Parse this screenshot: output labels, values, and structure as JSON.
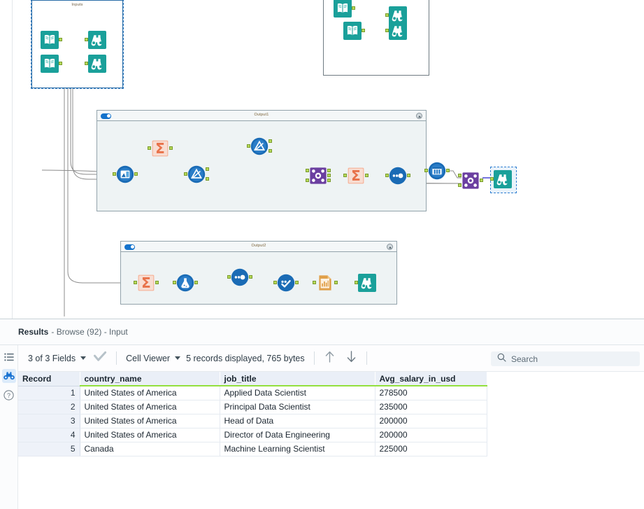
{
  "app": "Alteryx Designer Workflow Canvas",
  "canvas": {
    "containers": [
      {
        "id": "inputs",
        "label": "Inputs",
        "selected": true
      },
      {
        "id": "plain",
        "label": "",
        "selected": false
      },
      {
        "id": "output1",
        "label": "Output1",
        "selected": false,
        "toggle": "on",
        "collapse": "collapse-icon"
      },
      {
        "id": "output2",
        "label": "Output2",
        "selected": false,
        "toggle": "on",
        "collapse": "collapse-icon"
      }
    ],
    "tools": [
      {
        "name": "input-data-tool",
        "icon": "book-icon",
        "container": "inputs"
      },
      {
        "name": "browse-tool",
        "icon": "binoculars-icon",
        "container": "inputs"
      },
      {
        "name": "input-data-tool",
        "icon": "book-icon",
        "container": "inputs"
      },
      {
        "name": "browse-tool",
        "icon": "binoculars-icon",
        "container": "inputs"
      },
      {
        "name": "input-data-tool",
        "icon": "book-icon",
        "container": "plain"
      },
      {
        "name": "browse-tool",
        "icon": "binoculars-icon",
        "container": "plain"
      },
      {
        "name": "input-data-tool",
        "icon": "book-icon",
        "container": "plain"
      },
      {
        "name": "browse-tool",
        "icon": "binoculars-icon",
        "container": "plain"
      },
      {
        "name": "join-tool",
        "icon": "join-icon",
        "container": "output1"
      },
      {
        "name": "summarize-tool",
        "icon": "sigma-icon",
        "container": "output1"
      },
      {
        "name": "filter-tool",
        "icon": "filter-icon",
        "container": "output1"
      },
      {
        "name": "filter-tool",
        "icon": "filter-icon",
        "container": "output1"
      },
      {
        "name": "union-tool",
        "icon": "union-icon",
        "container": "output1"
      },
      {
        "name": "summarize-tool",
        "icon": "sigma-icon",
        "container": "output1"
      },
      {
        "name": "select-tool",
        "icon": "select-icon",
        "container": "output1"
      },
      {
        "name": "sort-tool",
        "icon": "sort-icon",
        "container": "output1"
      },
      {
        "name": "union-tool",
        "icon": "union-icon",
        "container": "output1"
      },
      {
        "name": "browse-tool",
        "icon": "binoculars-icon",
        "container": "output1",
        "selected": true
      },
      {
        "name": "summarize-tool",
        "icon": "sigma-icon",
        "container": "output2"
      },
      {
        "name": "sample-tool",
        "icon": "flask-icon",
        "container": "output2"
      },
      {
        "name": "select-tool",
        "icon": "select-icon",
        "container": "output2"
      },
      {
        "name": "formula-tool",
        "icon": "check-circle-icon",
        "container": "output2"
      },
      {
        "name": "output-data-tool",
        "icon": "output-doc-icon",
        "container": "output2"
      },
      {
        "name": "browse-tool",
        "icon": "binoculars-icon",
        "container": "output2"
      }
    ],
    "colors": {
      "teal": "#1aa09a",
      "orange_sigma": "#e8724a",
      "blue_tool": "#1a6bb5",
      "purple_union": "#6b3fa0",
      "orange_output": "#e0a04a",
      "anchor_green": "#b6d957"
    }
  },
  "results": {
    "title": "Results",
    "subtitle": "- Browse (92) - Input",
    "sidebar": [
      {
        "name": "field-list-icon",
        "active": false
      },
      {
        "name": "binoculars-icon",
        "active": true
      },
      {
        "name": "help-icon",
        "active": false
      }
    ],
    "toolbar": {
      "fields_label": "3 of 3 Fields",
      "view_label": "Cell Viewer",
      "records_label": "5 records displayed, 765 bytes",
      "up_arrow": "up-arrow-icon",
      "down_arrow": "down-arrow-icon",
      "check_icon": "checkmark-icon",
      "search_placeholder": "Search",
      "search_value": "",
      "search_icon": "search-icon"
    },
    "table": {
      "columns": [
        "Record",
        "country_name",
        "job_title",
        "Avg_salary_in_usd"
      ],
      "rows": [
        [
          "1",
          "United States of America",
          "Applied Data Scientist",
          "278500"
        ],
        [
          "2",
          "United States of America",
          "Principal Data Scientist",
          "235000"
        ],
        [
          "3",
          "United States of America",
          "Head of Data",
          "200000"
        ],
        [
          "4",
          "United States of America",
          "Director of Data Engineering",
          "200000"
        ],
        [
          "5",
          "Canada",
          "Machine Learning Scientist",
          "225000"
        ]
      ]
    }
  }
}
